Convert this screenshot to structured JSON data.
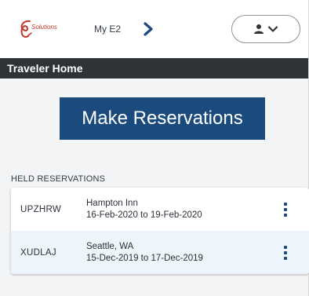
{
  "header": {
    "logo_text": "Solutions",
    "app_name": "My E2",
    "nav_icon": "chevron-right-icon",
    "user_menu_icons": [
      "user-icon",
      "chevron-down-icon"
    ]
  },
  "titlebar": {
    "title": "Traveler Home"
  },
  "main": {
    "make_reservations_label": "Make Reservations",
    "held_label": "HELD RESERVATIONS",
    "reservations": [
      {
        "code": "UPZHRW",
        "name": "Hampton Inn",
        "dates": "16-Feb-2020 to 19-Feb-2020"
      },
      {
        "code": "XUDLAJ",
        "name": "Seattle, WA",
        "dates": "15-Dec-2019 to 17-Dec-2019"
      }
    ]
  },
  "colors": {
    "primary": "#1b4a7d",
    "titlebar": "#2e3338",
    "row_alt": "#eef4fb",
    "logo": "#c0392b"
  }
}
